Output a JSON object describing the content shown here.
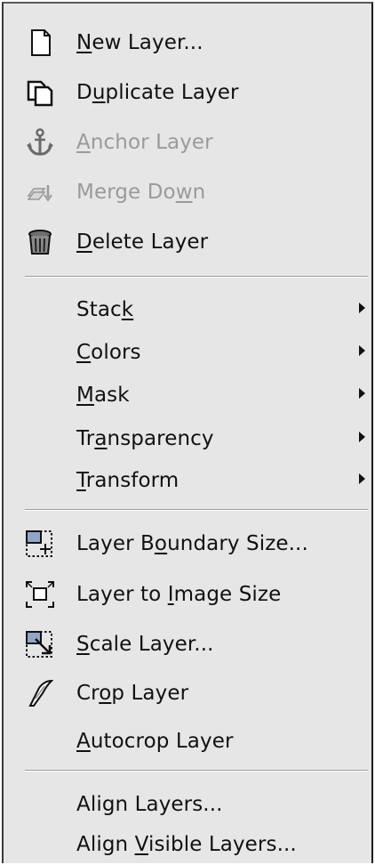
{
  "menu": {
    "groups": {
      "layer": [
        {
          "pre": "",
          "mn": "N",
          "post": "ew Layer...",
          "enabled": true,
          "icon": "new-layer-icon"
        },
        {
          "pre": "D",
          "mn": "u",
          "post": "plicate Layer",
          "enabled": true,
          "icon": "duplicate-layer-icon"
        },
        {
          "pre": "",
          "mn": "A",
          "post": "nchor Layer",
          "enabled": false,
          "icon": "anchor-icon"
        },
        {
          "pre": "Merge Do",
          "mn": "w",
          "post": "n",
          "enabled": false,
          "icon": "merge-down-icon"
        },
        {
          "pre": "",
          "mn": "D",
          "post": "elete Layer",
          "enabled": true,
          "icon": "delete-layer-icon"
        }
      ],
      "submenus": [
        {
          "pre": "Stac",
          "mn": "k",
          "post": "",
          "enabled": true,
          "submenu": true
        },
        {
          "pre": "",
          "mn": "C",
          "post": "olors",
          "enabled": true,
          "submenu": true
        },
        {
          "pre": "",
          "mn": "M",
          "post": "ask",
          "enabled": true,
          "submenu": true
        },
        {
          "pre": "Tr",
          "mn": "a",
          "post": "nsparency",
          "enabled": true,
          "submenu": true
        },
        {
          "pre": "",
          "mn": "T",
          "post": "ransform",
          "enabled": true,
          "submenu": true
        }
      ],
      "size": [
        {
          "pre": "Layer B",
          "mn": "o",
          "post": "undary Size...",
          "enabled": true,
          "icon": "layer-boundary-size-icon"
        },
        {
          "pre": "Layer to ",
          "mn": "I",
          "post": "mage Size",
          "enabled": true,
          "icon": "layer-to-image-size-icon"
        },
        {
          "pre": "",
          "mn": "S",
          "post": "cale Layer...",
          "enabled": true,
          "icon": "scale-layer-icon"
        },
        {
          "pre": "Cr",
          "mn": "o",
          "post": "p Layer",
          "enabled": true,
          "icon": "crop-layer-icon"
        },
        {
          "pre": "",
          "mn": "A",
          "post": "utocrop Layer",
          "enabled": true,
          "icon": ""
        }
      ],
      "align": [
        {
          "pre": "Align Layers...",
          "mn": "",
          "post": "",
          "enabled": true,
          "icon": ""
        },
        {
          "pre": "Align ",
          "mn": "V",
          "post": "isible Layers...",
          "enabled": true,
          "icon": ""
        }
      ]
    },
    "colors": {
      "background": "#e6e6e6",
      "text": "#111111",
      "disabled_text": "#9a9a9a",
      "separator": "#9c9c9c"
    }
  }
}
